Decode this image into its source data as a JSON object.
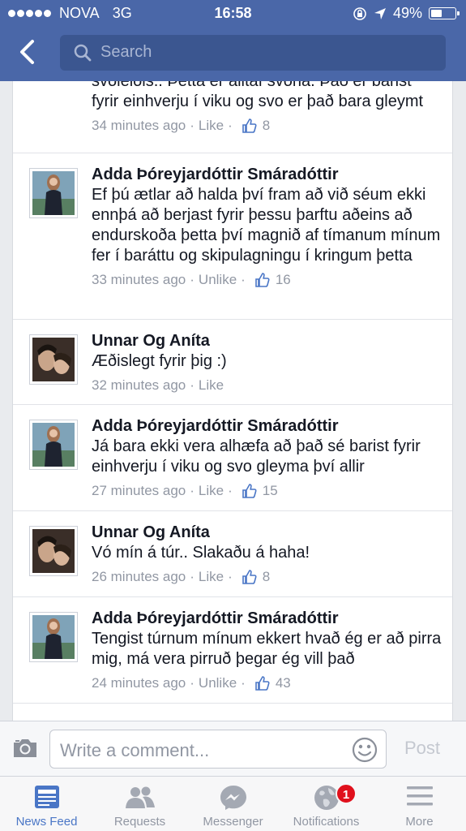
{
  "status_bar": {
    "carrier": "NOVA",
    "network": "3G",
    "time": "16:58",
    "battery": "49%",
    "battery_level": 0.49
  },
  "search": {
    "placeholder": "Search"
  },
  "comments": [
    {
      "name": "",
      "text": "svolelols.. Þetta er alltaf svona. Það er barist fyrir einhverju í viku og svo er það bara gleymt",
      "time": "34 minutes ago",
      "action": "Like",
      "likes": "8"
    },
    {
      "name": "Adda Þóreyjardóttir Smáradóttir",
      "text": "Ef þú ætlar að halda því fram að við séum ekki ennþá að berjast fyrir þessu þarftu aðeins að endurskoða þetta því magnið af tímanum mínum fer í baráttu og skipulagningu í kringum þetta",
      "time": "33 minutes ago",
      "action": "Unlike",
      "likes": "16"
    },
    {
      "name": "Unnar Og Aníta",
      "text": "Æðislegt fyrir þig :)",
      "time": "32 minutes ago",
      "action": "Like",
      "likes": ""
    },
    {
      "name": "Adda Þóreyjardóttir Smáradóttir",
      "text": "Já bara ekki vera alhæfa að það sé barist fyrir einhverju í viku og svo gleyma því allir",
      "time": "27 minutes ago",
      "action": "Like",
      "likes": "15"
    },
    {
      "name": "Unnar Og Aníta",
      "text": "Vó mín á túr.. Slakaðu á haha!",
      "time": "26 minutes ago",
      "action": "Like",
      "likes": "8"
    },
    {
      "name": "Adda Þóreyjardóttir Smáradóttir",
      "text": "Tengist túrnum mínum ekkert hvað ég er að pirra mig, má vera pirruð þegar ég vill það",
      "time": "24 minutes ago",
      "action": "Unlike",
      "likes": "43"
    }
  ],
  "composer": {
    "placeholder": "Write a comment...",
    "post_label": "Post"
  },
  "tabs": [
    {
      "label": "News Feed",
      "icon": "news-feed-icon",
      "active": true
    },
    {
      "label": "Requests",
      "icon": "friend-requests-icon"
    },
    {
      "label": "Messenger",
      "icon": "messenger-icon"
    },
    {
      "label": "Notifications",
      "icon": "globe-icon",
      "badge": "1"
    },
    {
      "label": "More",
      "icon": "menu-icon"
    }
  ],
  "colors": {
    "header": "#4a67a8",
    "accent": "#4a76c6",
    "badge": "#e0101c"
  }
}
